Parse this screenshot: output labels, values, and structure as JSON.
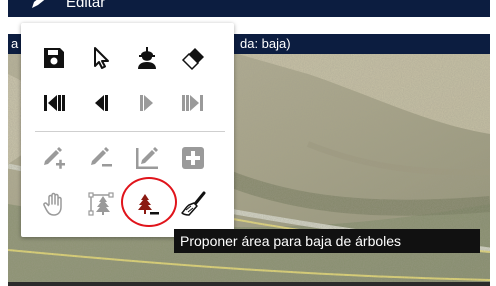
{
  "window": {
    "title": "Editar",
    "layer_bar_lead": "a",
    "layer_bar_text": "da: baja)"
  },
  "toolbar": {
    "rows": [
      [
        "save-icon",
        "cursor-arrow-icon",
        "worker-icon",
        "eraser-icon"
      ],
      [
        "first-icon",
        "previous-icon",
        "next-icon",
        "last-icon"
      ],
      [
        "add-point-icon",
        "edit-pencil-icon",
        "edit-line-icon",
        "add-box-icon"
      ],
      [
        "pan-hand-icon",
        "tree-vertices-icon",
        "tree-remove-icon",
        "brush-icon"
      ]
    ],
    "active_tool": "tree-remove-icon"
  },
  "tooltip": {
    "text": "Proponer área para baja de árboles"
  },
  "colors": {
    "header_bg": "#0c1d40",
    "icon_dark": "#111111",
    "icon_disabled": "#9a9a9a",
    "tree_active": "#8b1a12",
    "highlight_ring": "#e0141b",
    "tooltip_bg": "#111111"
  }
}
